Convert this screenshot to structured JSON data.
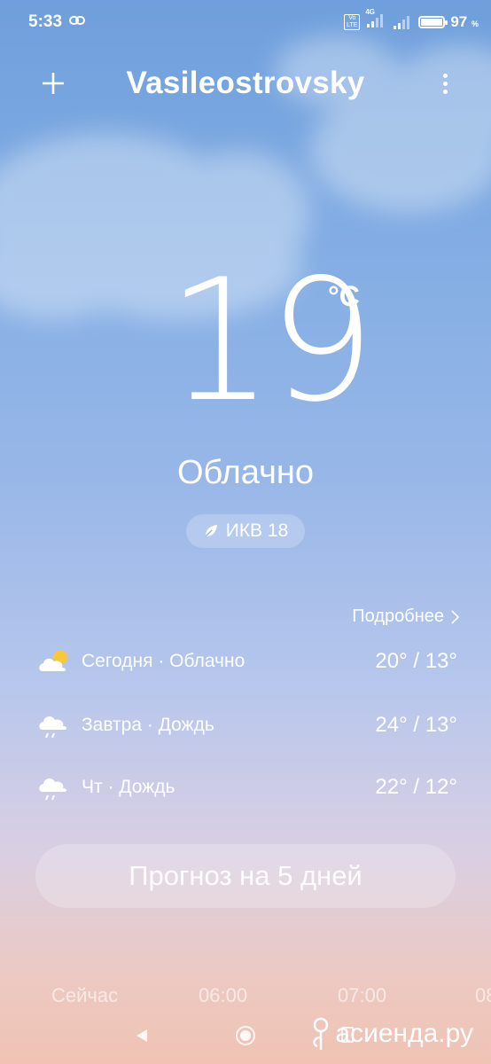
{
  "status_bar": {
    "time": "5:33",
    "volte": "Vo LTE",
    "network": "4G",
    "battery_percent": "97",
    "battery_unit": "%",
    "battery_level": 0.97
  },
  "header": {
    "city": "Vasileostrovsky",
    "add_icon": "plus-icon",
    "menu_icon": "more-vert-icon"
  },
  "current": {
    "temperature": "19",
    "unit": "°C",
    "condition": "Облачно",
    "aqi_label": "ИКВ 18"
  },
  "details_link": "Подробнее",
  "forecast": [
    {
      "label": "Сегодня · Облачно",
      "temps": "20° / 13°",
      "icon": "partly-cloudy-icon"
    },
    {
      "label": "Завтра · Дождь",
      "temps": "24° / 13°",
      "icon": "rain-icon"
    },
    {
      "label": "Чт · Дождь",
      "temps": "22° / 12°",
      "icon": "rain-icon"
    }
  ],
  "five_day_button": "Прогноз на 5 дней",
  "hourly": [
    "Сейчас",
    "06:00",
    "07:00",
    "08"
  ],
  "watermark": "асиенда.ру",
  "colors": {
    "sky_top": "#6f9fdc",
    "sky_bottom": "#f0c3b4",
    "sun": "#f7c83a"
  }
}
